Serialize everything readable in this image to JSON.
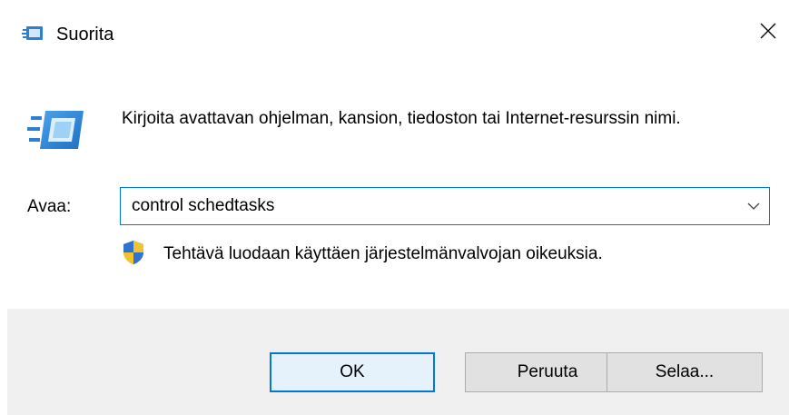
{
  "window": {
    "title": "Suorita",
    "title_icon": "run-icon",
    "close_icon": "close-icon"
  },
  "content": {
    "icon": "run-program-icon",
    "description": "Kirjoita avattavan ohjelman, kansion, tiedoston tai Internet-resurssin nimi.",
    "open_label": "Avaa:",
    "open_value": "control schedtasks",
    "dropdown_icon": "chevron-down-icon",
    "admin_icon": "uac-shield-icon",
    "admin_note": "Tehtävä luodaan käyttäen järjestelmänvalvojan oikeuksia."
  },
  "buttons": {
    "ok": "OK",
    "cancel": "Peruuta",
    "browse": "Selaa..."
  },
  "colors": {
    "accent": "#0078d7",
    "footer_bg": "#f0f0f0",
    "button_bg": "#e1e1e1",
    "button_border": "#adadad"
  }
}
